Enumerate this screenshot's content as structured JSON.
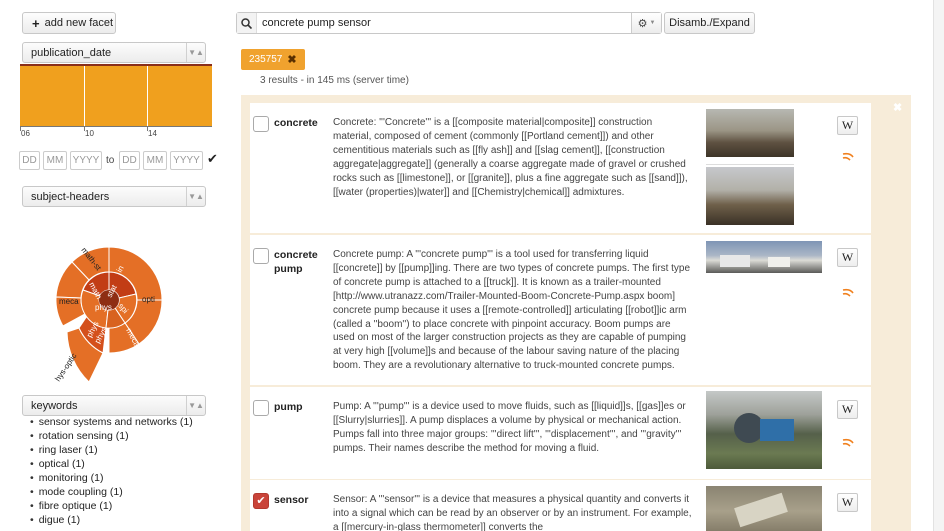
{
  "left": {
    "add_facet_label": "add new facet",
    "facet1": {
      "label": "publication_date",
      "tick_labels": [
        "06",
        "10",
        "14"
      ],
      "date_from": {
        "dd": "DD",
        "mm": "MM",
        "yyyy": "YYYY"
      },
      "to_label": "to",
      "date_to": {
        "dd": "DD",
        "mm": "MM",
        "yyyy": "YYYY"
      }
    },
    "facet2": {
      "label": "subject-headers",
      "sunburst_labels": [
        "math-st",
        "math",
        "stat",
        "in",
        "meca",
        "opti",
        "phys",
        "spi",
        "phys",
        "meca",
        "hys-optic",
        "phys"
      ]
    },
    "facet3": {
      "label": "keywords",
      "items": [
        "sensor systems and networks (1)",
        "rotation sensing (1)",
        "ring laser (1)",
        "optical (1)",
        "monitoring (1)",
        "mode coupling (1)",
        "fibre optique (1)",
        "digue (1)"
      ]
    }
  },
  "search": {
    "query": "concrete pump sensor",
    "disamb_label": "Disamb./Expand",
    "chip_label": "235757",
    "stats": "3 results - in 145 ms (server time)"
  },
  "results": [
    {
      "term": "concrete",
      "checked": false,
      "text": "Concrete: '''Concrete''' is a [[composite material|composite]] construction material, composed of cement (commonly [[Portland cement]]) and other cementitious materials such as [[fly ash]] and [[slag cement]], [[construction aggregate|aggregate]] (generally a coarse aggregate made of gravel or crushed rocks such as [[limestone]], or [[granite]], plus a fine aggregate such as [[sand]]), [[water (properties)|water]] and [[Chemistry|chemical]] admixtures."
    },
    {
      "term": "concrete pump",
      "checked": false,
      "text": "Concrete pump: A '''concrete pump''' is a tool used for transferring liquid [[concrete]] by [[pump]]ing. There are two types of concrete pumps. The first type of concrete pump is attached to a [[truck]]. It is known as a trailer-mounted [http://www.utranazz.com/Trailer-Mounted-Boom-Concrete-Pump.aspx boom] concrete pump because it uses a [[remote-controlled]] articulating [[robot]]ic arm (called a ''boom'') to place concrete with pinpoint accuracy. Boom pumps are used on most of the larger construction projects as they are capable of pumping at very high [[volume]]s and because of the labour saving nature of the placing boom. They are a revolutionary alternative to truck-mounted concrete pumps."
    },
    {
      "term": "pump",
      "checked": false,
      "text": "Pump: A '''pump''' is a device used to move fluids, such as [[liquid]]s, [[gas]]es or [[Slurry|slurries]]. A pump displaces a volume by physical or mechanical action. Pumps fall into three major groups: '''direct lift''', '''displacement''', and '''gravity''' pumps. Their names describe the method for moving a fluid."
    },
    {
      "term": "sensor",
      "checked": true,
      "text": "Sensor: A '''sensor''' is a device that measures a physical quantity and converts it into a signal which can be read by an observer or by an instrument. For example, a [[mercury-in-glass thermometer]] converts the"
    }
  ],
  "icons": {
    "plus": "plus-icon",
    "search": "search-icon",
    "gear": "gear-icon",
    "check": "checkmark-icon",
    "close": "close-icon",
    "wikipedia": "wikipedia-icon",
    "rss": "rss-icon"
  },
  "colors": {
    "accent": "#f0a22e",
    "histogram": "#f0a01e",
    "checked": "#c9443a",
    "panel_bg": "#f7ecd9"
  }
}
